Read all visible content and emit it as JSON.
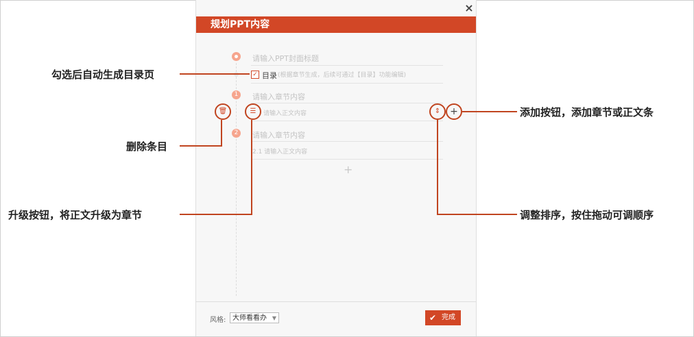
{
  "dialog": {
    "title": "规划PPT内容",
    "close_glyph": "×",
    "cover_placeholder": "请输入PPT封面标题",
    "toc_label": "目录",
    "toc_hint": "(根据章节生成，后续可通过【目录】功能编辑)",
    "sections": [
      {
        "number": "1",
        "placeholder": "请输入章节内容",
        "body_placeholder": "请输入正文内容"
      },
      {
        "number": "2",
        "placeholder": "请输入章节内容",
        "body_placeholder": "2.1  请输入正文内容"
      }
    ],
    "add_glyph": "+",
    "style_label": "风格:",
    "style_value": "大师看看办",
    "style_arrow": "▼",
    "done_label": "完成",
    "done_glyph": "✔"
  },
  "callouts": {
    "toc_checkbox": "勾选后自动生成目录页",
    "delete": "删除条目",
    "promote": "升级按钮，将正文升级为章节",
    "add": "添加按钮，添加章节或正文条",
    "reorder": "调整排序，按住拖动可调顺序"
  },
  "icons": {
    "delete": "trash-icon",
    "promote": "promote-icon",
    "reorder": "drag-reorder-icon",
    "add": "plus-icon"
  },
  "colors": {
    "accent": "#d24726",
    "callout_line": "#c0441f",
    "section_number": "#f6a58e"
  }
}
